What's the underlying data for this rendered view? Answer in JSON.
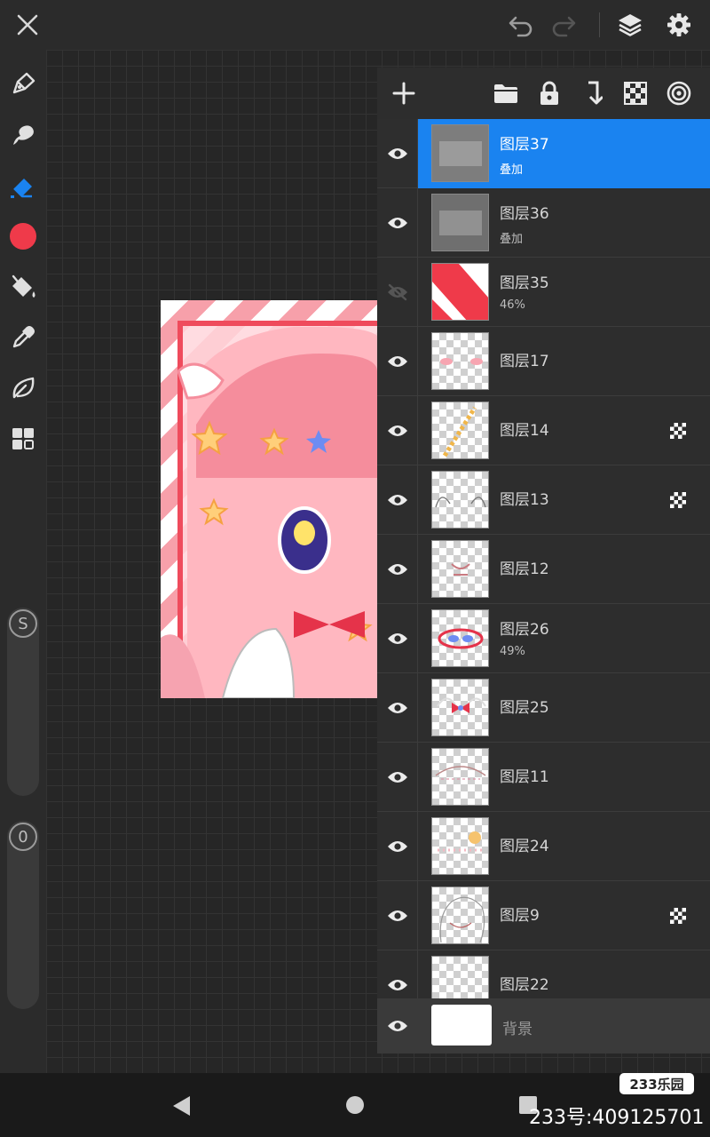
{
  "colors": {
    "accent": "#1a83f0",
    "current_brush_color": "#ef3a4a",
    "panel_bg": "#2d2d2d",
    "canvas_bg": "#262626"
  },
  "icons": {
    "topbar": [
      "close-icon",
      "undo-icon",
      "redo-icon",
      "layers-icon",
      "settings-icon"
    ],
    "left_tools": [
      "brush-tool-icon",
      "smudge-tool-icon",
      "eraser-tool-icon",
      "color-swatch",
      "fill-bucket-icon",
      "eyedropper-icon",
      "leaf-icon",
      "grid-apps-icon"
    ],
    "layer_toolbar": [
      "add-layer-icon",
      "folder-icon",
      "lock-icon",
      "merge-down-icon",
      "checker-icon",
      "target-icon"
    ]
  },
  "left_toolbar": {
    "active_tool": "eraser",
    "size_slider_label": "S",
    "opacity_slider_label": "0"
  },
  "layers": [
    {
      "name": "图层37",
      "sub": "叠加",
      "visible": true,
      "selected": true,
      "alpha_lock": false
    },
    {
      "name": "图层36",
      "sub": "叠加",
      "visible": true,
      "selected": false,
      "alpha_lock": false
    },
    {
      "name": "图层35",
      "sub": "46%",
      "visible": false,
      "selected": false,
      "alpha_lock": false
    },
    {
      "name": "图层17",
      "sub": "",
      "visible": true,
      "selected": false,
      "alpha_lock": false
    },
    {
      "name": "图层14",
      "sub": "",
      "visible": true,
      "selected": false,
      "alpha_lock": true
    },
    {
      "name": "图层13",
      "sub": "",
      "visible": true,
      "selected": false,
      "alpha_lock": true
    },
    {
      "name": "图层12",
      "sub": "",
      "visible": true,
      "selected": false,
      "alpha_lock": false
    },
    {
      "name": "图层26",
      "sub": "49%",
      "visible": true,
      "selected": false,
      "alpha_lock": false
    },
    {
      "name": "图层25",
      "sub": "",
      "visible": true,
      "selected": false,
      "alpha_lock": false
    },
    {
      "name": "图层11",
      "sub": "",
      "visible": true,
      "selected": false,
      "alpha_lock": false
    },
    {
      "name": "图层24",
      "sub": "",
      "visible": true,
      "selected": false,
      "alpha_lock": false
    },
    {
      "name": "图层9",
      "sub": "",
      "visible": true,
      "selected": false,
      "alpha_lock": true
    },
    {
      "name": "图层22",
      "sub": "",
      "visible": true,
      "selected": false,
      "alpha_lock": false
    }
  ],
  "background_layer": {
    "name": "背景",
    "visible": true
  },
  "watermark": {
    "logo": "233乐园",
    "id_text": "233号:409125701"
  }
}
